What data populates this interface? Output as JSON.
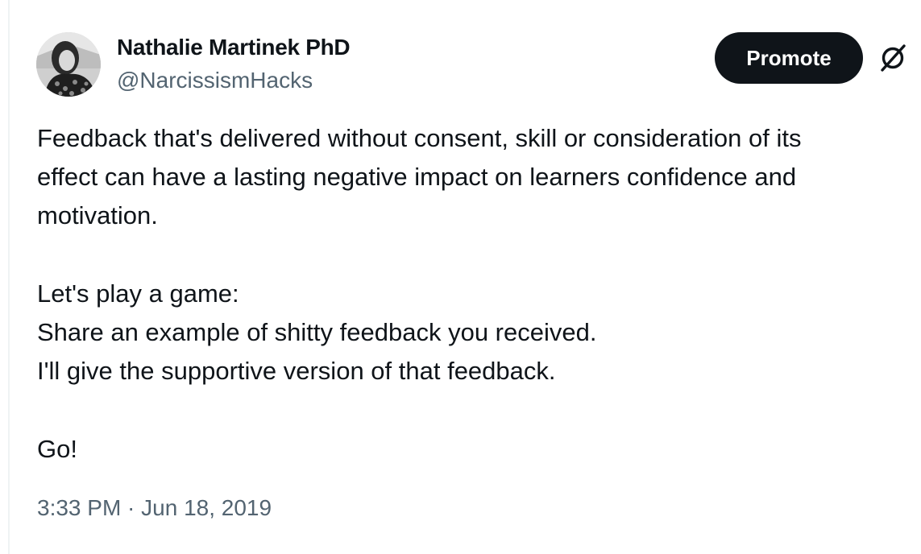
{
  "tweet": {
    "author": {
      "display_name": "Nathalie Martinek PhD",
      "handle": "@NarcissismHacks",
      "avatar_icon": "profile-photo"
    },
    "actions": {
      "promote_label": "Promote",
      "more_icon": "grok-slash-icon"
    },
    "text_lines": [
      "Feedback that's delivered without consent, skill or consideration of its",
      "effect can have a lasting negative impact on learners confidence and",
      "motivation.",
      "",
      "Let's play a game:",
      "Share an example of shitty feedback you received.",
      "I'll give the supportive version of that feedback.",
      "",
      "Go!"
    ],
    "timestamp": "3:33 PM · Jun 18, 2019"
  },
  "colors": {
    "text_primary": "#0f1419",
    "text_secondary": "#536471",
    "button_bg": "#0f1419",
    "button_text": "#ffffff"
  }
}
